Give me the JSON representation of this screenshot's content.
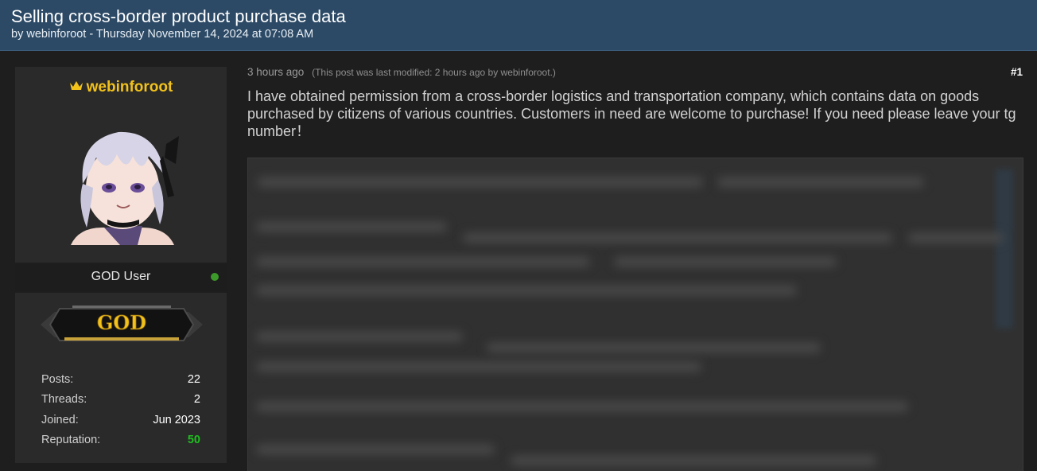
{
  "thread": {
    "title": "Selling cross-border product purchase data",
    "byline": "by webinforoot - Thursday November 14, 2024 at 07:08 AM"
  },
  "user": {
    "username": "webinforoot",
    "rank_title": "GOD User",
    "badge_text": "GOD",
    "stats": [
      {
        "label": "Posts:",
        "value": "22"
      },
      {
        "label": "Threads:",
        "value": "2"
      },
      {
        "label": "Joined:",
        "value": "Jun 2023"
      },
      {
        "label": "Reputation:",
        "value": "50"
      }
    ]
  },
  "post": {
    "time": "3 hours ago",
    "modified": "(This post was last modified: 2 hours ago by webinforoot.)",
    "number": "#1",
    "body": "I have obtained permission from a cross-border logistics and transportation company, which contains data on goods purchased by citizens of various countries. Customers in need are welcome to purchase! If you need please leave your tg number！"
  },
  "colors": {
    "header_bg": "#2c4a66",
    "username": "#f2c21b",
    "reputation": "#1fbf1f",
    "online": "#3c9a2a"
  }
}
